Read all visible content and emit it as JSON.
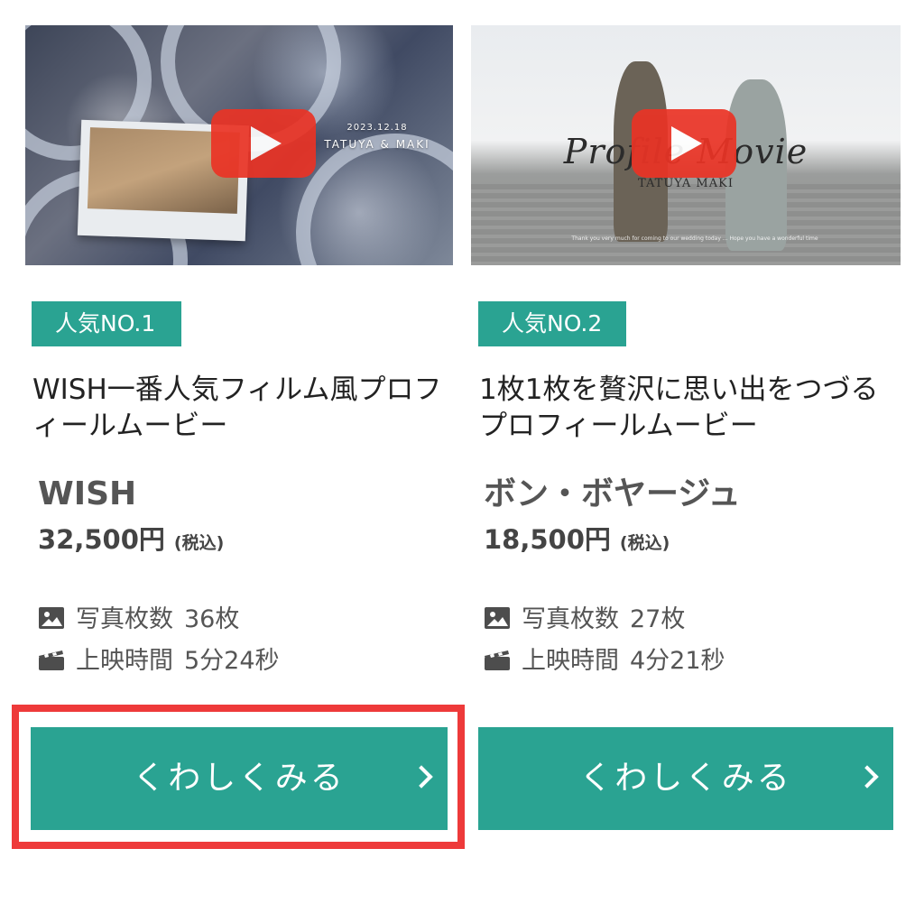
{
  "products": [
    {
      "thumbnail": {
        "date": "2023.12.18",
        "names": "TATUYA & MAKI",
        "play_icon": "play-icon"
      },
      "rank": "人気NO.1",
      "catch_line_1": "WISH一番人気フィルム風プロフ",
      "catch_line_2": "ィールムービー",
      "name": "WISH",
      "price": "32,500円",
      "tax": "(税込)",
      "photos_label": "写真枚数",
      "photos_value": "36枚",
      "duration_label": "上映時間",
      "duration_value": "5分24秒",
      "button_label": "くわしくみる"
    },
    {
      "thumbnail": {
        "title": "Profile Movie",
        "names": "TATUYA MAKI",
        "message": "Thank you very much for coming to our wedding today ... Hope you have a wonderful time",
        "play_icon": "play-icon"
      },
      "rank": "人気NO.2",
      "catch_line_1": "1枚1枚を贅沢に思い出をつづる",
      "catch_line_2": "プロフィールムービー",
      "name": "ボン・ボヤージュ",
      "price": "18,500円",
      "tax": "(税込)",
      "photos_label": "写真枚数",
      "photos_value": "27枚",
      "duration_label": "上映時間",
      "duration_value": "4分21秒",
      "button_label": "くわしくみる"
    }
  ],
  "colors": {
    "accent": "#2aa392",
    "highlight": "#ee3a3a",
    "play": "#ea3325"
  }
}
